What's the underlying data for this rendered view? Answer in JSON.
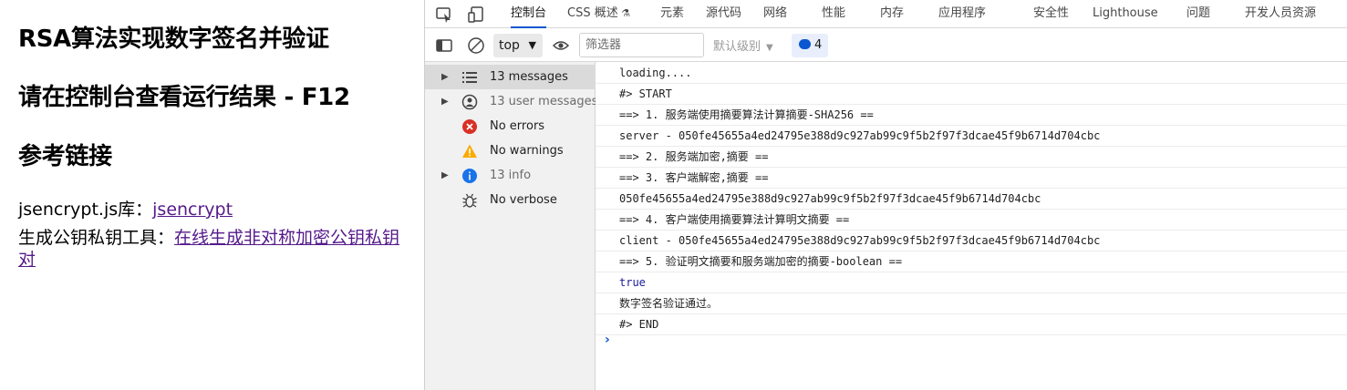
{
  "page": {
    "title": "RSA算法实现数字签名并验证",
    "subtitle": "请在控制台查看运行结果 - F12",
    "ref_heading": "参考链接",
    "lib_label": "jsencrypt.js库：",
    "lib_link": "jsencrypt",
    "tool_label": "生成公钥私钥工具：",
    "tool_link": "在线生成非对称加密公钥私钥对"
  },
  "devtools": {
    "tabs": [
      "控制台",
      "CSS 概述",
      "元素",
      "源代码",
      "网络",
      "性能",
      "内存",
      "应用程序",
      "安全性",
      "Lighthouse",
      "问题",
      "开发人员资源"
    ],
    "active_tab": "控制台",
    "toolbar": {
      "context": "top",
      "filter_placeholder": "筛选器",
      "levels": "默认级别",
      "issues_count": "4"
    },
    "sidebar": [
      {
        "label": "13 messages",
        "icon": "list-icon",
        "expandable": true,
        "selected": true
      },
      {
        "label": "13 user messages",
        "icon": "user-icon",
        "expandable": true,
        "selected": false
      },
      {
        "label": "No errors",
        "icon": "error-icon",
        "expandable": false,
        "selected": false
      },
      {
        "label": "No warnings",
        "icon": "warning-icon",
        "expandable": false,
        "selected": false
      },
      {
        "label": "13 info",
        "icon": "info-icon",
        "expandable": true,
        "selected": false
      },
      {
        "label": "No verbose",
        "icon": "bug-icon",
        "expandable": false,
        "selected": false
      }
    ],
    "logs": [
      "loading....",
      "#> START",
      "==> 1. 服务端使用摘要算法计算摘要-SHA256 ==",
      "server - 050fe45655a4ed24795e388d9c927ab99c9f5b2f97f3dcae45f9b6714d704cbc",
      "==> 2. 服务端加密,摘要 ==",
      "==> 3. 客户端解密,摘要 ==",
      "050fe45655a4ed24795e388d9c927ab99c9f5b2f97f3dcae45f9b6714d704cbc",
      "==> 4. 客户端使用摘要算法计算明文摘要 ==",
      "client - 050fe45655a4ed24795e388d9c927ab99c9f5b2f97f3dcae45f9b6714d704cbc",
      "==> 5. 验证明文摘要和服务端加密的摘要-boolean ==",
      "true",
      "数字签名验证通过。",
      "#> END"
    ],
    "colors": {
      "accent": "#0b57d0",
      "error": "#d93025",
      "warning": "#f9ab00",
      "info": "#1a73e8"
    }
  }
}
